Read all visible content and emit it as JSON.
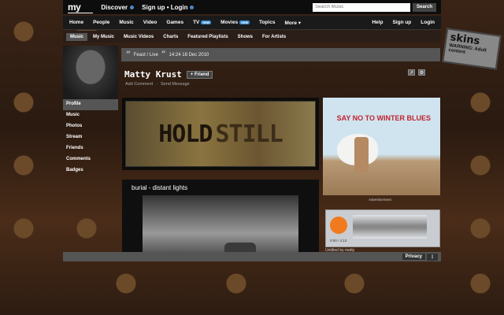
{
  "topbar": {
    "logo": "my",
    "discover": "Discover",
    "signup_login": "Sign up • Login",
    "search_placeholder": "Search Music",
    "search_button": "Search"
  },
  "mainnav": {
    "items": [
      {
        "label": "Home"
      },
      {
        "label": "People"
      },
      {
        "label": "Music"
      },
      {
        "label": "Video"
      },
      {
        "label": "Games"
      },
      {
        "label": "TV",
        "badge": "new"
      },
      {
        "label": "Movies",
        "badge": "new"
      },
      {
        "label": "Topics"
      },
      {
        "label": "More ▾"
      }
    ],
    "right": [
      {
        "label": "Help"
      },
      {
        "label": "Sign up"
      },
      {
        "label": "Login"
      }
    ]
  },
  "subnav": {
    "items": [
      "Music",
      "My Music",
      "Music Videos",
      "Charts",
      "Featured Playlists",
      "Shows",
      "For Artists"
    ]
  },
  "sidebar": {
    "items": [
      "Profile",
      "Music",
      "Photos",
      "Stream",
      "Friends",
      "Comments",
      "Badges"
    ]
  },
  "status": {
    "text": "Feast / Live",
    "timestamp": "14:24 18 Dec 2010"
  },
  "profile": {
    "name": "Matty Krust",
    "friend_button": "Friend",
    "add_comment": "Add Comment",
    "send_message": "Send Message"
  },
  "banner": {
    "word1": "HOLD",
    "word2": "STILL"
  },
  "ad": {
    "text": "SAY NO TO WINTER BLUES",
    "label": "Advertisement"
  },
  "video": {
    "title": "burial - distant lights"
  },
  "player": {
    "time": "0:00 / 4:13",
    "track": "Untitled by matty"
  },
  "footer": {
    "privacy": "Privacy",
    "more": "⋮"
  },
  "skins": {
    "title": "skins",
    "warning": "WARNING: Adult content"
  },
  "colors": {
    "accent_blue": "#3a8ad0",
    "player_orange": "#f07a1d",
    "ad_red": "#c3222f"
  }
}
